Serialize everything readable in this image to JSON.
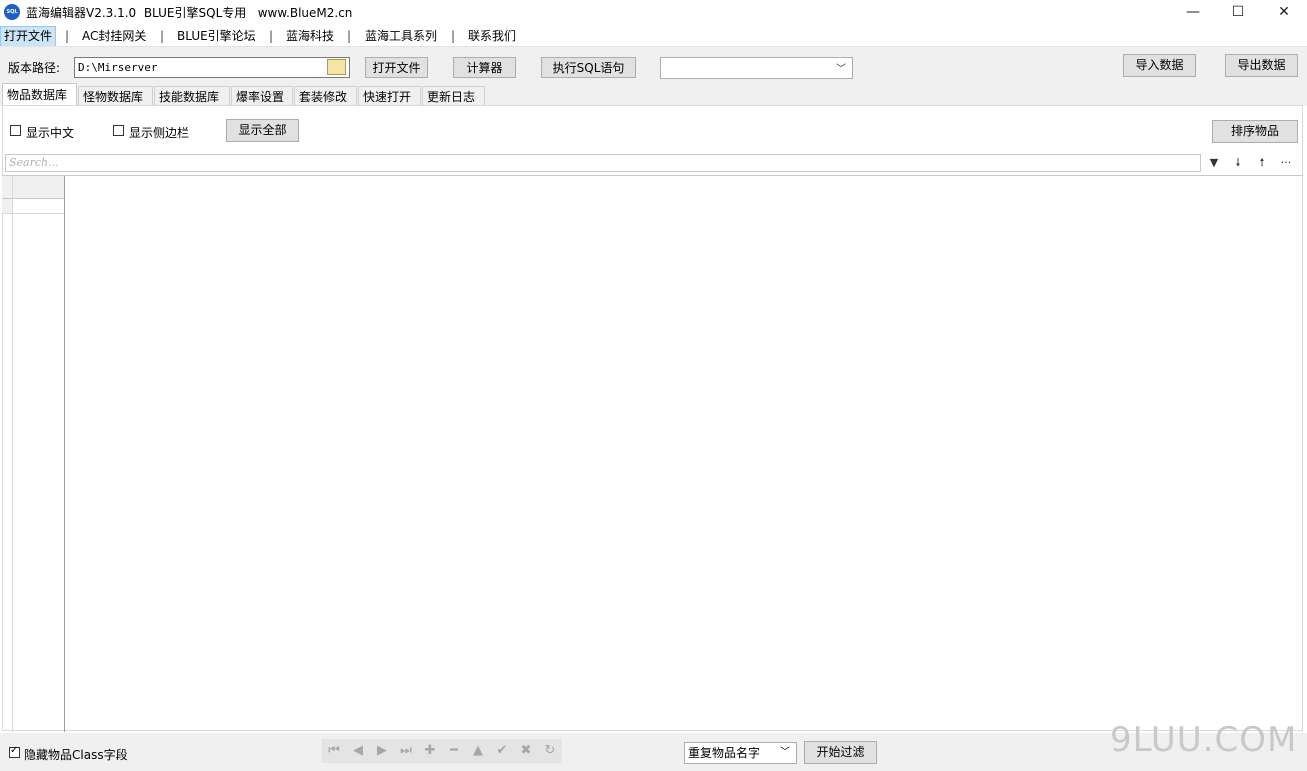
{
  "window": {
    "icon_text": "SQL",
    "title": "蓝海编辑器V2.3.1.0  BLUE引擎SQL专用   www.BlueM2.cn",
    "minimize_glyph": "—",
    "maximize_glyph": "☐",
    "close_glyph": "✕"
  },
  "menu": {
    "items": [
      "打开文件",
      "AC封挂网关",
      "BLUE引擎论坛",
      "蓝海科技",
      "蓝海工具系列",
      "联系我们"
    ],
    "separator": "|"
  },
  "toolbar": {
    "path_label": "版本路径:",
    "path_value": "D:\\Mirserver",
    "open_file": "打开文件",
    "calculator": "计算器",
    "exec_sql": "执行SQL语句",
    "combo_value": "",
    "import_data": "导入数据",
    "export_data": "导出数据"
  },
  "tabs": [
    "物品数据库",
    "怪物数据库",
    "技能数据库",
    "爆率设置",
    "套装修改",
    "快速打开",
    "更新日志"
  ],
  "panel": {
    "show_chinese": "显示中文",
    "show_chinese_checked": false,
    "show_sidebar": "显示侧边栏",
    "show_sidebar_checked": false,
    "show_all": "显示全部",
    "sort_items": "排序物品",
    "search_placeholder": "Search..."
  },
  "footer": {
    "hide_class": "隐藏物品Class字段",
    "hide_class_checked": true,
    "dup_select_value": "重复物品名字",
    "start_filter": "开始过滤",
    "watermark": "9LUU.COM"
  }
}
